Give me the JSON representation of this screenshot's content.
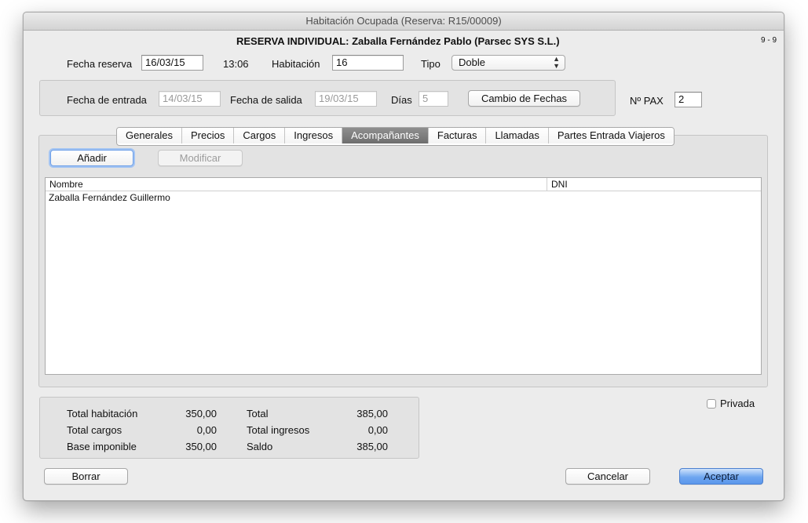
{
  "window": {
    "title": "Habitación Ocupada (Reserva: R15/00009)",
    "heading": "RESERVA INDIVIDUAL: Zaballa Fernández Pablo (Parsec SYS S.L.)",
    "page_indicator": "9 - 9"
  },
  "reserva": {
    "fecha_reserva_label": "Fecha reserva",
    "fecha_reserva_value": "16/03/15",
    "hora": "13:06",
    "habitacion_label": "Habitación",
    "habitacion_value": "16",
    "tipo_label": "Tipo",
    "tipo_value": "Doble"
  },
  "fechas": {
    "entrada_label": "Fecha de entrada",
    "entrada_value": "14/03/15",
    "salida_label": "Fecha de salida",
    "salida_value": "19/03/15",
    "dias_label": "Días",
    "dias_value": "5",
    "cambio_button": "Cambio de Fechas",
    "pax_label": "Nº PAX",
    "pax_value": "2"
  },
  "tabs": [
    {
      "label": "Generales",
      "active": false
    },
    {
      "label": "Precios",
      "active": false
    },
    {
      "label": "Cargos",
      "active": false
    },
    {
      "label": "Ingresos",
      "active": false
    },
    {
      "label": "Acompañantes",
      "active": true
    },
    {
      "label": "Facturas",
      "active": false
    },
    {
      "label": "Llamadas",
      "active": false
    },
    {
      "label": "Partes Entrada Viajeros",
      "active": false
    }
  ],
  "acompanantes": {
    "add_button": "Añadir",
    "modify_button": "Modificar",
    "columns": [
      "Nombre",
      "DNI"
    ],
    "rows": [
      {
        "nombre": "Zaballa Fernández Guillermo",
        "dni": ""
      }
    ]
  },
  "totales": {
    "total_habitacion_label": "Total habitación",
    "total_habitacion_value": "350,00",
    "total_cargos_label": "Total cargos",
    "total_cargos_value": "0,00",
    "base_imponible_label": "Base imponible",
    "base_imponible_value": "350,00",
    "total_label": "Total",
    "total_value": "385,00",
    "total_ingresos_label": "Total ingresos",
    "total_ingresos_value": "0,00",
    "saldo_label": "Saldo",
    "saldo_value": "385,00"
  },
  "privada_label": "Privada",
  "privada_checked": false,
  "footer": {
    "borrar": "Borrar",
    "cancelar": "Cancelar",
    "aceptar": "Aceptar"
  },
  "colors": {
    "accent": "#5b97ec",
    "window_bg": "#ececec",
    "active_tab": "#7a7a7a"
  }
}
